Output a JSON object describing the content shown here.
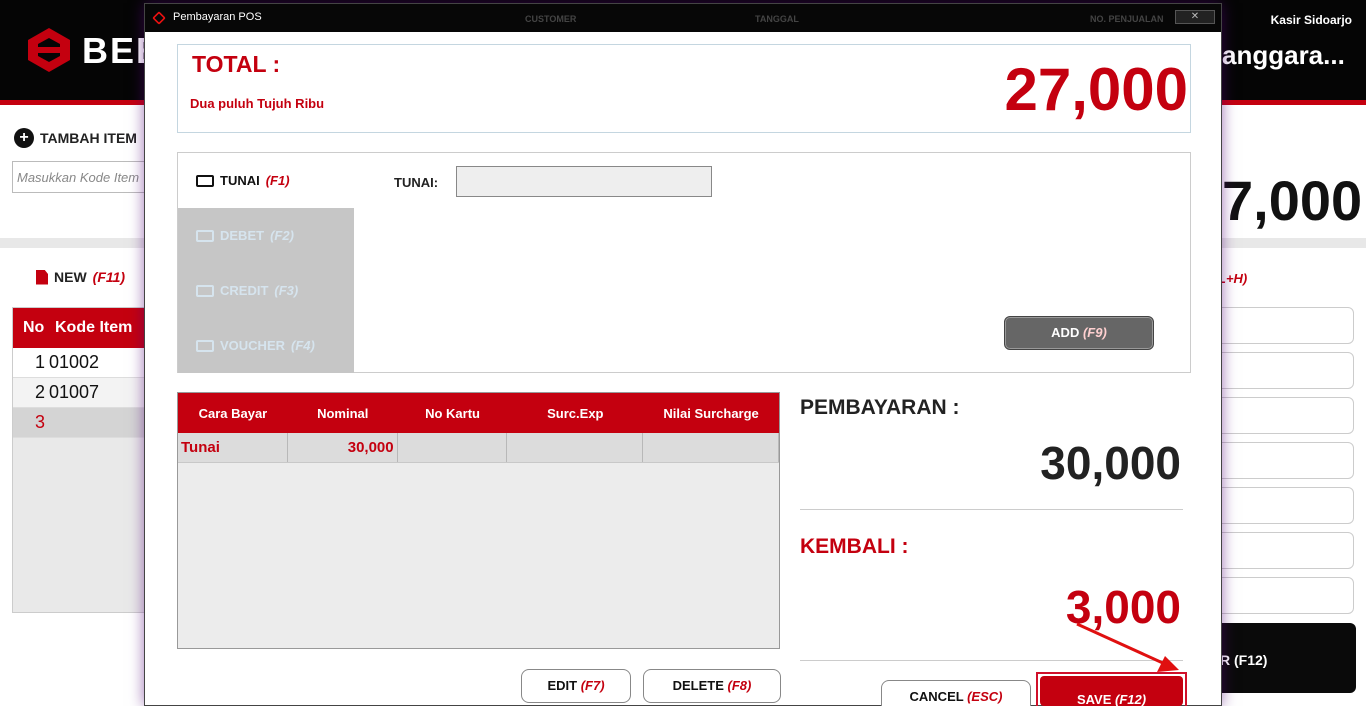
{
  "background_app": {
    "brand": "BEE",
    "header_columns": [
      "CUSTOMER",
      "TANGGAL",
      "NO. PENJUALAN"
    ],
    "kasir": "Kasir Sidoarjo",
    "pelanggan": "anggara...",
    "tambah_item": "TAMBAH ITEM",
    "kode_placeholder": "Masukkan Kode Item",
    "new_label": "NEW",
    "new_shortcut": "(F11)",
    "table_headers": [
      "No",
      "Kode Item"
    ],
    "rows": [
      {
        "no": "1",
        "kode": "01002"
      },
      {
        "no": "2",
        "kode": "01007"
      },
      {
        "no": "3",
        "kode": ""
      }
    ],
    "total_partial": "7,000",
    "shortcut_right": "L+H)",
    "bayar_button": "R (F12)"
  },
  "modal": {
    "title": "Pembayaran POS",
    "close_symbol": "✕",
    "total_label": "TOTAL :",
    "total_words": "Dua puluh Tujuh Ribu",
    "total_value": "27,000",
    "tabs": [
      {
        "label": "TUNAI",
        "shortcut": "(F1)",
        "icon": "cash-icon"
      },
      {
        "label": "DEBET",
        "shortcut": "(F2)",
        "icon": "card-icon"
      },
      {
        "label": "CREDIT",
        "shortcut": "(F3)",
        "icon": "card-icon"
      },
      {
        "label": "VOUCHER",
        "shortcut": "(F4)",
        "icon": "voucher-icon"
      }
    ],
    "tunai_label": "TUNAI:",
    "tunai_value": "",
    "add_label": "ADD",
    "add_shortcut": "(F9)",
    "table_headers": [
      "Cara Bayar",
      "Nominal",
      "No Kartu",
      "Surc.Exp",
      "Nilai Surcharge"
    ],
    "payments": [
      {
        "cara_bayar": "Tunai",
        "nominal": "30,000",
        "no_kartu": "",
        "surc_exp": "",
        "nilai_surcharge": ""
      }
    ],
    "edit_label": "EDIT",
    "edit_shortcut": "(F7)",
    "delete_label": "DELETE",
    "delete_shortcut": "(F8)",
    "pembayaran_label": "PEMBAYARAN :",
    "pembayaran_value": "30,000",
    "kembali_label": "KEMBALI :",
    "kembali_value": "3,000",
    "cancel_label": "CANCEL",
    "cancel_shortcut": "(ESC)",
    "save_label": "SAVE",
    "save_shortcut": "(F12)"
  },
  "colors": {
    "accent_red": "#c4000f",
    "header_black": "#050505",
    "arrow_red": "#e01010"
  }
}
